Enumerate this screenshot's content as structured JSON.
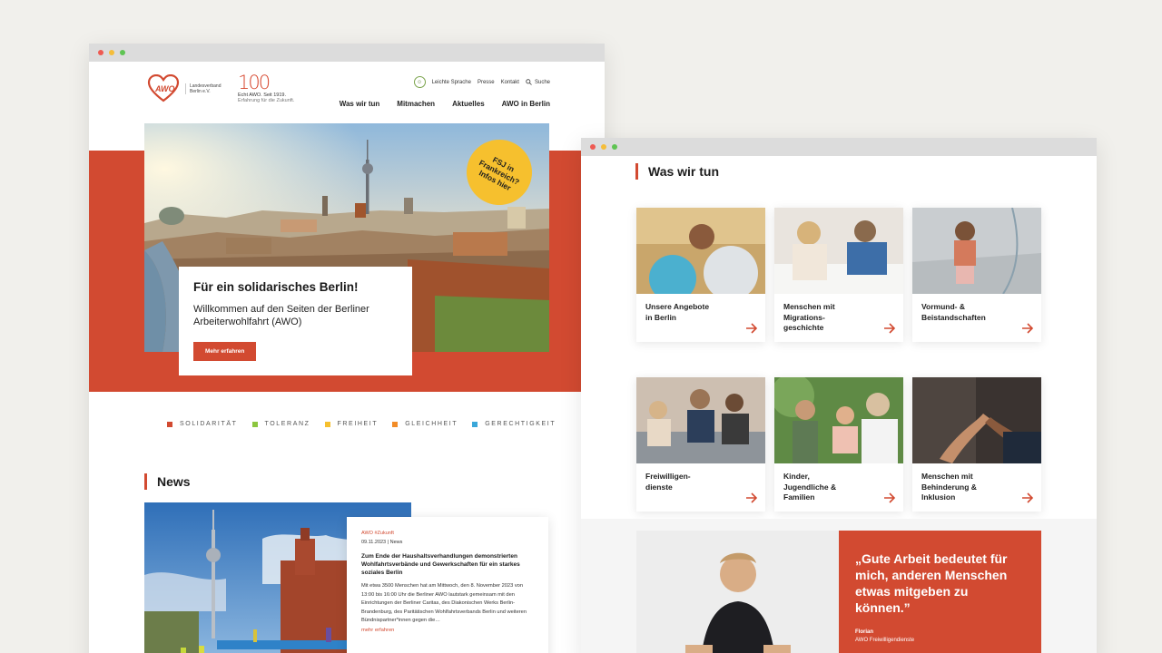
{
  "window_left": {
    "logo": {
      "brand": "AWO",
      "subtitle_line1": "Landesverband",
      "subtitle_line2": "Berlin e.V."
    },
    "anniversary": {
      "number": "100",
      "line1": "Echt AWO. Seit 1919.",
      "line2": "Erfahrung für die Zukunft."
    },
    "topmeta": {
      "easy_language": "Leichte Sprache",
      "press": "Presse",
      "contact": "Kontakt",
      "search": "Suche"
    },
    "nav": [
      "Was wir tun",
      "Mitmachen",
      "Aktuelles",
      "AWO in Berlin"
    ],
    "badge": {
      "line1": "FSJ in",
      "line2": "Frankreich?",
      "line3": "Infos hier"
    },
    "hero": {
      "title": "Für ein solidarisches Berlin!",
      "text": "Willkommen auf den Seiten der Berliner Arbeiterwohlfahrt (AWO)",
      "button": "Mehr erfahren"
    },
    "values": [
      {
        "label": "SOLIDARITÄT",
        "color": "#d24a31"
      },
      {
        "label": "TOLERANZ",
        "color": "#8cc63f"
      },
      {
        "label": "FREIHEIT",
        "color": "#f6c02e"
      },
      {
        "label": "GLEICHHEIT",
        "color": "#f28c28"
      },
      {
        "label": "GERECHTIGKEIT",
        "color": "#3aa7d9"
      }
    ],
    "news": {
      "heading": "News",
      "category": "AWO #Zukunft",
      "date": "09.11.2023 | News",
      "title": "Zum Ende der Haushaltsverhandlungen demonstrierten Wohlfahrtsverbände und Gewerkschaften für ein starkes soziales Berlin",
      "text": "Mit etwa 3500 Menschen hat am Mittwoch, den 8. November 2023 von 13:00 bis 16:00 Uhr die Berliner AWO lautstark gemeinsam mit den Einrichtungen der Berliner Caritas, des Diakonischen Werks Berlin-Brandenburg, des Paritätischen Wohlfahrtsverbands Berlin und weiteren Bündnispartner*innen gegen die…",
      "more": "mehr erfahren"
    }
  },
  "window_right": {
    "heading": "Was wir tun",
    "tiles": [
      {
        "label": "Unsere Angebote\nin Berlin"
      },
      {
        "label": "Menschen mit\nMigrations-\ngeschichte"
      },
      {
        "label": "Vormund- &\nBeistandschaften"
      },
      {
        "label": "Freiwilligen-\ndienste"
      },
      {
        "label": "Kinder,\nJugendliche &\nFamilien"
      },
      {
        "label": "Menschen mit\nBehinderung &\nInklusion"
      }
    ],
    "quote": {
      "text": "„Gute Arbeit bedeutet für mich, anderen Menschen etwas mitgeben zu können.”",
      "name": "Florian",
      "role": "AWO Freiwilligendienste"
    }
  },
  "colors": {
    "brand_red": "#d24a31",
    "badge_yellow": "#f6c02e"
  }
}
